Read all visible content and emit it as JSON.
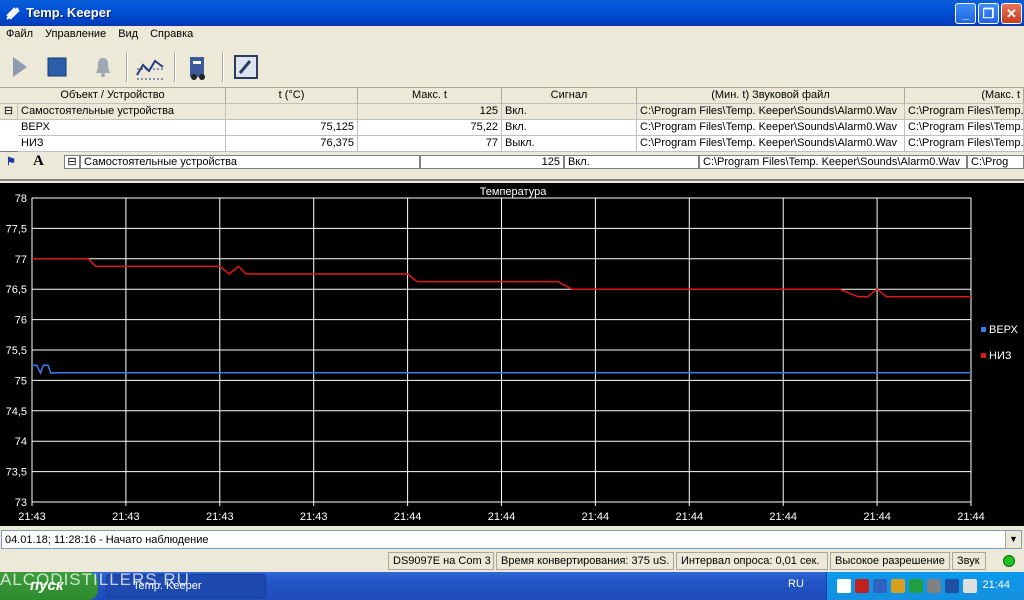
{
  "window": {
    "title": "Temp. Keeper"
  },
  "menu": [
    "Файл",
    "Управление",
    "Вид",
    "Справка"
  ],
  "table": {
    "headers": [
      "Объект / Устройство",
      "t (°C)",
      "Макс. t",
      "Сигнал",
      "(Мин. t) Звуковой файл",
      "(Макс. t"
    ],
    "group": {
      "name": "Самостоятельные устройства",
      "max": "125",
      "signal": "Вкл.",
      "file_min": "C:\\Program Files\\Temp. Keeper\\Sounds\\Alarm0.Wav",
      "file_max": "C:\\Program Files\\Temp."
    },
    "rows": [
      {
        "name": "ВЕРХ",
        "t": "75,125",
        "max": "75,22",
        "signal": "Вкл.",
        "file_min": "C:\\Program Files\\Temp. Keeper\\Sounds\\Alarm0.Wav",
        "file_max": "C:\\Program Files\\Temp."
      },
      {
        "name": "НИЗ",
        "t": "76,375",
        "max": "77",
        "signal": "Выкл.",
        "file_min": "C:\\Program Files\\Temp. Keeper\\Sounds\\Alarm0.Wav",
        "file_max": "C:\\Program Files\\Temp."
      }
    ]
  },
  "ghost": {
    "group": "Самостоятельные устройства",
    "max": "125",
    "signal": "Вкл.",
    "file": "C:\\Program Files\\Temp. Keeper\\Sounds\\Alarm0.Wav",
    "file2": "C:\\Prog"
  },
  "chart_data": {
    "type": "line",
    "title": "Температура",
    "ylim": [
      73,
      78
    ],
    "yticks": [
      "73",
      "73,5",
      "74",
      "74,5",
      "75",
      "75,5",
      "76",
      "76,5",
      "77",
      "77,5",
      "78"
    ],
    "xticks": [
      "21:43",
      "21:43",
      "21:43",
      "21:43",
      "21:44",
      "21:44",
      "21:44",
      "21:44",
      "21:44",
      "21:44",
      "21:44"
    ],
    "grid": true,
    "legend_position": "right",
    "series": [
      {
        "name": "ВЕРХ",
        "color": "#3a7bf0",
        "x": [
          0,
          0.05,
          0.09,
          0.12,
          0.17,
          0.2,
          0.25,
          0.5,
          1,
          2,
          3,
          4,
          5,
          6,
          7,
          8,
          9,
          10
        ],
        "y": [
          75.25,
          75.25,
          75.12,
          75.25,
          75.25,
          75.12,
          75.125,
          75.125,
          75.125,
          75.125,
          75.125,
          75.125,
          75.125,
          75.125,
          75.125,
          75.125,
          75.125,
          75.125
        ]
      },
      {
        "name": "НИЗ",
        "color": "#e01818",
        "x": [
          0,
          0.6,
          0.68,
          1,
          2,
          2.1,
          2.2,
          2.28,
          2.4,
          3,
          4,
          4.1,
          5,
          5.6,
          5.75,
          6,
          7,
          8,
          8.5,
          8.6,
          8.8,
          8.9,
          9,
          9.1,
          9.3,
          10
        ],
        "y": [
          77,
          77,
          76.875,
          76.875,
          76.875,
          76.75,
          76.875,
          76.75,
          76.75,
          76.75,
          76.75,
          76.625,
          76.625,
          76.625,
          76.5,
          76.5,
          76.5,
          76.5,
          76.5,
          76.5,
          76.375,
          76.375,
          76.5,
          76.375,
          76.375,
          76.375
        ]
      }
    ]
  },
  "log": "04.01.18; 11:28:16 - Начато наблюдение",
  "status": {
    "device": "DS9097E на Com 3",
    "conv": "Время конвертирования: 375 uS.",
    "interval": "Интервал опроса: 0,01 сек.",
    "res": "Высокое разрешение",
    "sound": "Звук"
  },
  "taskbar": {
    "start": "пуск",
    "item": "Temp. Keeper",
    "lang": "RU",
    "clock": "21:44",
    "watermark": "ALCODISTILLERS.RU"
  }
}
